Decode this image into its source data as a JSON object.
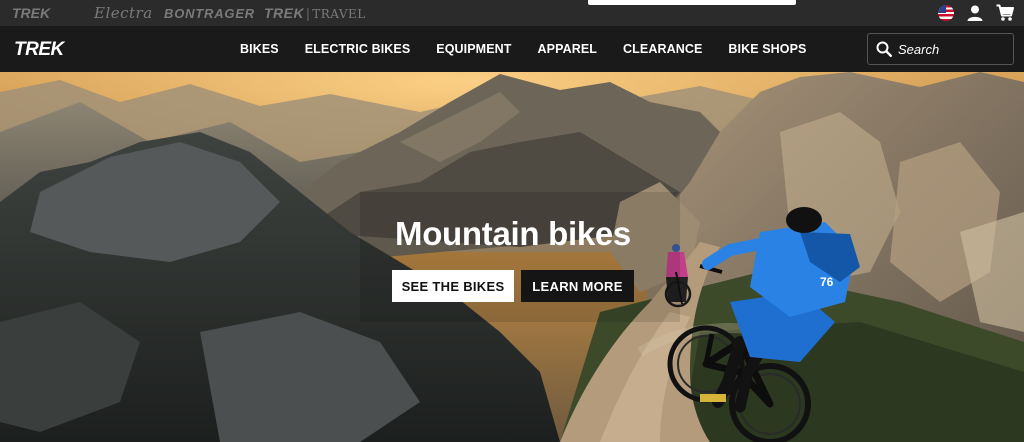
{
  "brands": {
    "trek": "TREK",
    "electra": "Electra",
    "bontrager": "BONTRAGER",
    "trek_travel_trek": "TREK",
    "trek_travel_sep": "|",
    "trek_travel_travel": "TRAVEL"
  },
  "utility_icons": [
    "us-flag-icon",
    "user-icon",
    "cart-icon"
  ],
  "logo": "TREK",
  "nav": {
    "items": [
      {
        "label": "BIKES"
      },
      {
        "label": "ELECTRIC BIKES"
      },
      {
        "label": "EQUIPMENT"
      },
      {
        "label": "APPAREL"
      },
      {
        "label": "CLEARANCE"
      },
      {
        "label": "BIKE SHOPS"
      }
    ]
  },
  "search": {
    "placeholder": "Search",
    "icon": "search-icon"
  },
  "hero": {
    "headline": "Mountain bikes",
    "primary_cta": "SEE THE BIKES",
    "secondary_cta": "LEARN MORE",
    "jersey_number": "76"
  },
  "colors": {
    "nav_bg": "#1a1a1a",
    "brandbar_bg": "#2b2b2b",
    "jersey_blue": "#1f6fd1"
  }
}
